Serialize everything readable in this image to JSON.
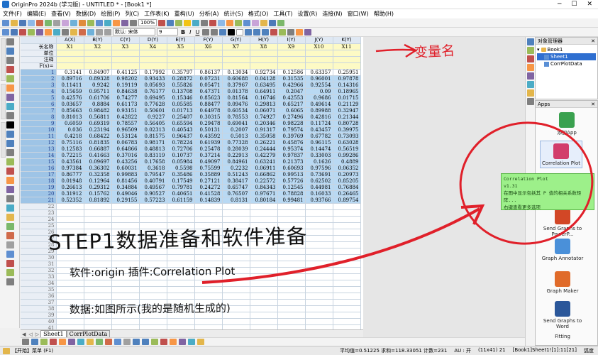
{
  "window": {
    "title": "OriginPro 2024b (学习版) - UNTITLED * - [Book1 *]"
  },
  "menu": [
    "文件(F)",
    "编辑(E)",
    "查看(V)",
    "数据(D)",
    "绘图(P)",
    "列(C)",
    "工作表(K)",
    "重构(U)",
    "分析(A)",
    "统计(S)",
    "格式(O)",
    "工具(T)",
    "设置(R)",
    "连接(N)",
    "窗口(W)",
    "帮助(H)"
  ],
  "toolbar": {
    "zoom": "100%",
    "font": "默认: 宋体",
    "font_size": "9"
  },
  "sheet": {
    "columns": [
      "A(X)",
      "B(Y)",
      "C(Y)",
      "D(Y)",
      "E(Y)",
      "F(Y)",
      "G(Y)",
      "H(Y)",
      "I(Y)",
      "J(Y)",
      "K(Y)"
    ],
    "meta_labels": [
      "长名称",
      "单位",
      "注释",
      "F(x)="
    ],
    "long_names": [
      "X1",
      "X2",
      "X3",
      "X4",
      "X5",
      "X6",
      "X7",
      "X8",
      "X9",
      "X10",
      "X11"
    ],
    "rows": [
      [
        "0.3141",
        "0.84907",
        "0.41125",
        "0.17992",
        "0.35797",
        "0.86137",
        "0.13034",
        "0.92734",
        "0.12586",
        "0.63357",
        "0.25951"
      ],
      [
        "0.89716",
        "0.89328",
        "0.98202",
        "0.93433",
        "0.28872",
        "0.07231",
        "0.60688",
        "0.04128",
        "0.31535",
        "0.96001",
        "0.97878"
      ],
      [
        "0.11411",
        "0.9242",
        "0.19119",
        "0.05693",
        "0.55826",
        "0.05471",
        "0.37967",
        "0.63495",
        "0.42966",
        "0.92554",
        "0.14316"
      ],
      [
        "0.15659",
        "0.95711",
        "0.84638",
        "0.76177",
        "0.13708",
        "0.47371",
        "0.01378",
        "0.64911",
        "0.2047",
        "0.09",
        "0.18965"
      ],
      [
        "0.42576",
        "0.61706",
        "0.74277",
        "0.69495",
        "0.15346",
        "0.85623",
        "0.81564",
        "0.16746",
        "0.42553",
        "0.9686",
        "0.01715"
      ],
      [
        "0.03657",
        "0.8884",
        "0.61173",
        "0.77628",
        "0.05585",
        "0.88477",
        "0.09476",
        "0.29813",
        "0.65217",
        "0.49614",
        "0.21129"
      ],
      [
        "0.85663",
        "0.98482",
        "0.93151",
        "0.50601",
        "0.01713",
        "0.64978",
        "0.60534",
        "0.06071",
        "0.6065",
        "0.89988",
        "0.32947"
      ],
      [
        "0.81013",
        "0.56811",
        "0.42822",
        "0.9227",
        "0.25407",
        "0.30315",
        "0.78553",
        "0.74927",
        "0.27496",
        "0.42816",
        "0.21344"
      ],
      [
        "0.6059",
        "0.69319",
        "0.78557",
        "0.56405",
        "0.65594",
        "0.29478",
        "0.69041",
        "0.20346",
        "0.98228",
        "0.11724",
        "0.80728"
      ],
      [
        "0.036",
        "0.23194",
        "0.96509",
        "0.02313",
        "0.40543",
        "0.50131",
        "0.2007",
        "0.91317",
        "0.79574",
        "0.43457",
        "0.39975"
      ],
      [
        "0.4218",
        "0.68422",
        "0.53124",
        "0.81575",
        "0.96437",
        "0.43592",
        "0.5013",
        "0.35058",
        "0.39769",
        "0.67782",
        "0.73093"
      ],
      [
        "0.75116",
        "0.81835",
        "0.06783",
        "0.98171",
        "0.78224",
        "0.61939",
        "0.77328",
        "0.26221",
        "0.45876",
        "0.96115",
        "0.63028"
      ],
      [
        "0.12583",
        "0.66887",
        "0.64866",
        "0.48813",
        "0.72706",
        "0.25478",
        "0.28039",
        "0.24444",
        "0.95374",
        "0.14474",
        "0.56519"
      ],
      [
        "0.72215",
        "0.41663",
        "0.37016",
        "0.83119",
        "0.10737",
        "0.37214",
        "0.22913",
        "0.42279",
        "0.97837",
        "0.33003",
        "0.99286"
      ],
      [
        "0.43561",
        "0.09697",
        "0.43256",
        "0.17658",
        "0.05984",
        "0.49097",
        "0.84961",
        "0.63241",
        "0.21373",
        "0.1626",
        "0.4889"
      ],
      [
        "0.97384",
        "0.36302",
        "0.60031",
        "0.3618",
        "0.5598",
        "0.75599",
        "0.2232",
        "0.06911",
        "0.60693",
        "0.97596",
        "0.06352"
      ],
      [
        "0.86777",
        "0.32358",
        "0.99883",
        "0.79547",
        "0.35486",
        "0.35889",
        "0.51243",
        "0.66862",
        "0.99513",
        "0.73691",
        "0.20973"
      ],
      [
        "0.01948",
        "0.12964",
        "0.81456",
        "0.40791",
        "0.17549",
        "0.27121",
        "0.38417",
        "0.22572",
        "0.57726",
        "0.62502",
        "0.85205"
      ],
      [
        "0.26613",
        "0.29312",
        "0.34884",
        "0.49567",
        "0.79781",
        "0.24272",
        "0.65747",
        "0.84343",
        "0.12545",
        "0.44981",
        "0.76884"
      ],
      [
        "0.31912",
        "0.15762",
        "0.49046",
        "0.90527",
        "0.40651",
        "0.41528",
        "0.76507",
        "0.97671",
        "0.78828",
        "0.16033",
        "0.26465"
      ],
      [
        "0.52352",
        "0.81892",
        "0.29155",
        "0.57223",
        "0.61159",
        "0.14839",
        "0.8131",
        "0.80184",
        "0.99481",
        "0.93766",
        "0.89754"
      ]
    ],
    "tabs": [
      "Sheet1",
      "CorrPlotData"
    ]
  },
  "object_manager": {
    "title": "对象管理器",
    "items": [
      "Book1",
      "Sheet1",
      "CorrPlotData"
    ]
  },
  "apps": {
    "title": "Apps",
    "items": [
      "添加App",
      "Correlation Plot",
      "Send Graphs to PowerP...",
      "Graph Annotator",
      "Graph Maker",
      "Send Graphs to Word",
      "Fitting"
    ]
  },
  "tooltip": {
    "title": "Correlation Plot",
    "version": "v1.31",
    "desc": "在图中显示包括其 P 值的相关系数矩阵...",
    "hint": "右键查看更多选项"
  },
  "status": {
    "start": "【开始】菜单 (F1)",
    "stats": "平均值=0.51225 求和=118.33051 计数=231",
    "au": "AU : 开",
    "dims": "(11x41) 21",
    "sheetref": "[Book1]Sheet1![1]:11[21]",
    "angle": "弧度"
  },
  "annotations": {
    "red_label": "变量名",
    "step": "STEP1数据准备和软件准备",
    "software": "软件:origin 插件:Correlation Plot",
    "data": "数据:如图所示(我的是随机生成的)"
  },
  "colors": {
    "selection": "#b9d9f3",
    "meta": "#fdfac5",
    "annotation_red": "#e0202a",
    "tooltip": "#9df08a"
  }
}
